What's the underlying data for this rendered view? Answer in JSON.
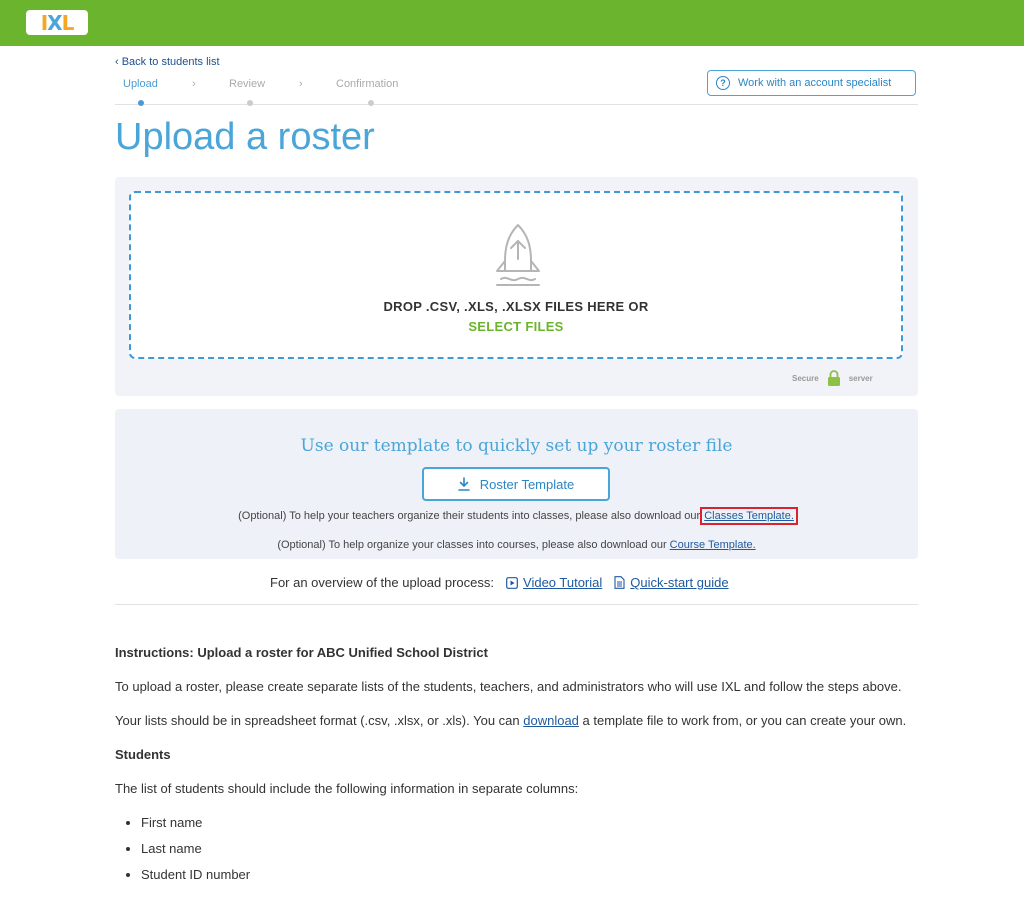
{
  "header": {
    "logo_text": "IXL",
    "logo_colors": [
      "#f5a623",
      "#4aa5d9",
      "#f5a623"
    ]
  },
  "nav": {
    "back_label": "‹ Back to students list"
  },
  "steps": [
    {
      "label": "Upload",
      "active": true
    },
    {
      "label": "Review",
      "active": false
    },
    {
      "label": "Confirmation",
      "active": false
    }
  ],
  "step_separator": "›",
  "specialist_button": {
    "label": "Work with an account specialist",
    "icon": "question-bubble-icon"
  },
  "page_title": "Upload a roster",
  "dropzone": {
    "instruction": "DROP .CSV, .XLS, .XLSX FILES HERE OR",
    "select_label": "SELECT FILES",
    "secure_left": "Secure",
    "secure_right": "server",
    "icon": "rocket-upload-icon"
  },
  "template": {
    "heading": "Use our template to quickly set up your roster file",
    "button_label": "Roster Template",
    "optional_classes_text": "(Optional) To help your teachers organize their students into classes, please also download our ",
    "classes_link": "Classes Template.",
    "optional_courses_text": "(Optional) To help organize your classes into courses, please also download our ",
    "courses_link": "Course Template."
  },
  "overview": {
    "label": "For an overview of the upload process:",
    "video_link": "Video Tutorial",
    "guide_link": "Quick-start guide"
  },
  "instructions": {
    "heading": "Instructions: Upload a roster for ABC Unified School District",
    "para1": "To upload a roster, please create separate lists of the students, teachers, and administrators who will use IXL and follow the steps above.",
    "para2_before": "Your lists should be in spreadsheet format (.csv, .xlsx, or .xls). You can ",
    "para2_link": "download",
    "para2_after": " a template file to work from, or you can create your own.",
    "students_heading": "Students",
    "students_intro": "The list of students should include the following information in separate columns:",
    "student_fields": [
      "First name",
      "Last name",
      "Student ID number"
    ]
  },
  "colors": {
    "brand_green": "#6bb42e",
    "accent_blue": "#4aa5d9",
    "link_blue": "#1f5aa0",
    "highlight_red": "#d9232f"
  }
}
